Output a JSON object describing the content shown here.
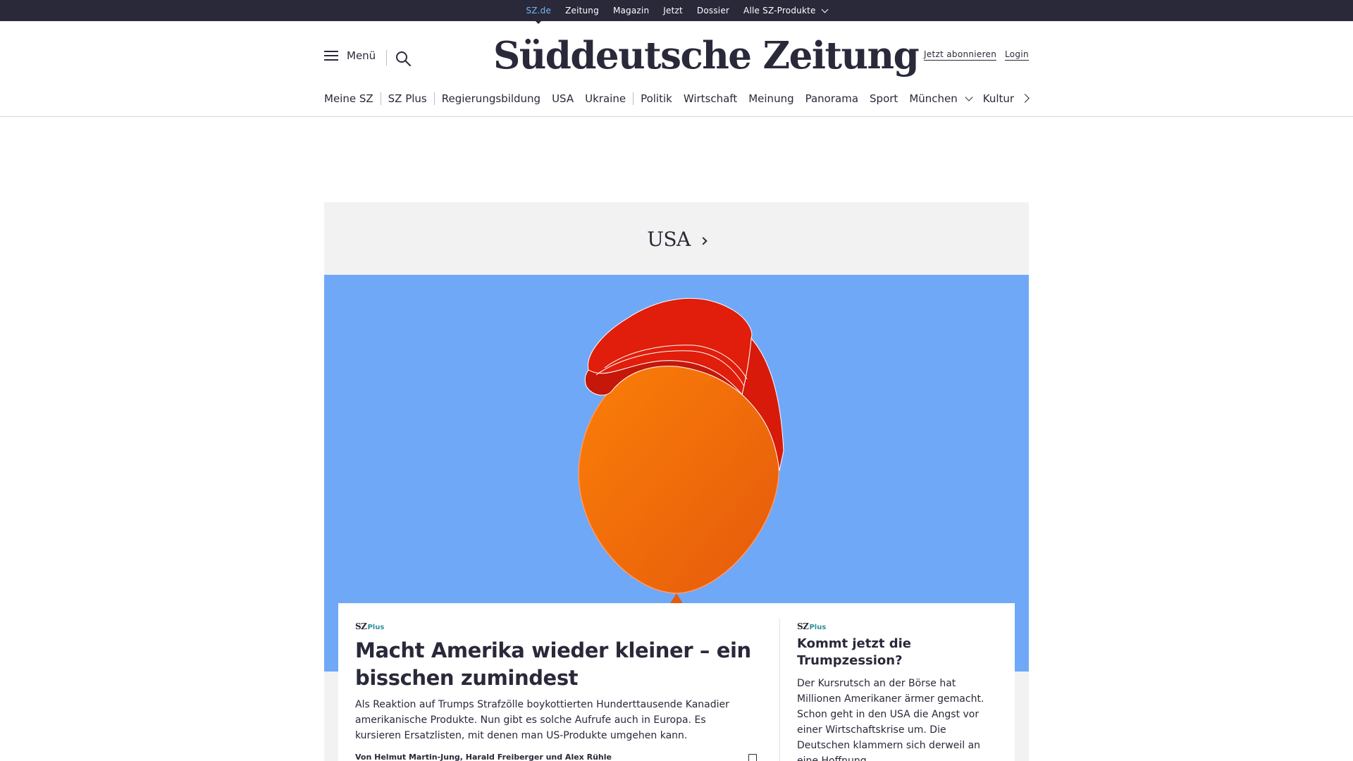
{
  "topbar": {
    "items": [
      {
        "label": "SZ.de",
        "active": true
      },
      {
        "label": "Zeitung"
      },
      {
        "label": "Magazin"
      },
      {
        "label": "Jetzt"
      },
      {
        "label": "Dossier"
      },
      {
        "label": "Alle SZ-Produkte",
        "dropdown": true
      }
    ]
  },
  "header": {
    "menu_label": "Menü",
    "logo": "Süddeutsche Zeitung",
    "subscribe_label": "Jetzt abonnieren",
    "login_label": "Login",
    "icons": {
      "menu": "hamburger-icon",
      "search": "search-icon",
      "nav_next": "chevron-right-icon"
    }
  },
  "nav": {
    "items": [
      "Meine SZ",
      "SZ Plus",
      "Regierungsbildung",
      "USA",
      "Ukraine",
      "Politik",
      "Wirtschaft",
      "Meinung",
      "Panorama",
      "Sport",
      "München",
      "Kultur"
    ]
  },
  "section": {
    "title": "USA"
  },
  "colors": {
    "dark": "#29293a",
    "hero_bg": "#6fa8f7",
    "cap_red": "#e01e0b",
    "face_orange": "#f26c0a",
    "plus_teal": "#2e8f9a",
    "active_link": "#73b7f0"
  },
  "main_article": {
    "badge_sz": "SZ",
    "badge_plus": "Plus",
    "title": "Macht Amerika wieder kleiner – ein bisschen zumindest",
    "description": "Als Reaktion auf Trumps Strafzölle boykottierten Hunderttausende Kanadier amerikanische Produkte.  Nun gibt es solche Aufrufe auch in Europa. Es kursieren Ersatzlisten, mit denen man US-Produkte umgehen kann.",
    "author": "Von Helmut Martin-Jung, Harald Freiberger und Alex Rühle",
    "bookmark_icon": "bookmark-icon"
  },
  "side_article": {
    "badge_sz": "SZ",
    "badge_plus": "Plus",
    "title": "Kommt jetzt die Trumpzession?",
    "description": "Der Kursrutsch an der Börse hat Millionen Amerikaner ärmer gemacht. Schon geht in den USA die Angst vor einer Wirtschaftskrise um. Die Deutschen klammern sich derweil an eine Hoffnung."
  }
}
